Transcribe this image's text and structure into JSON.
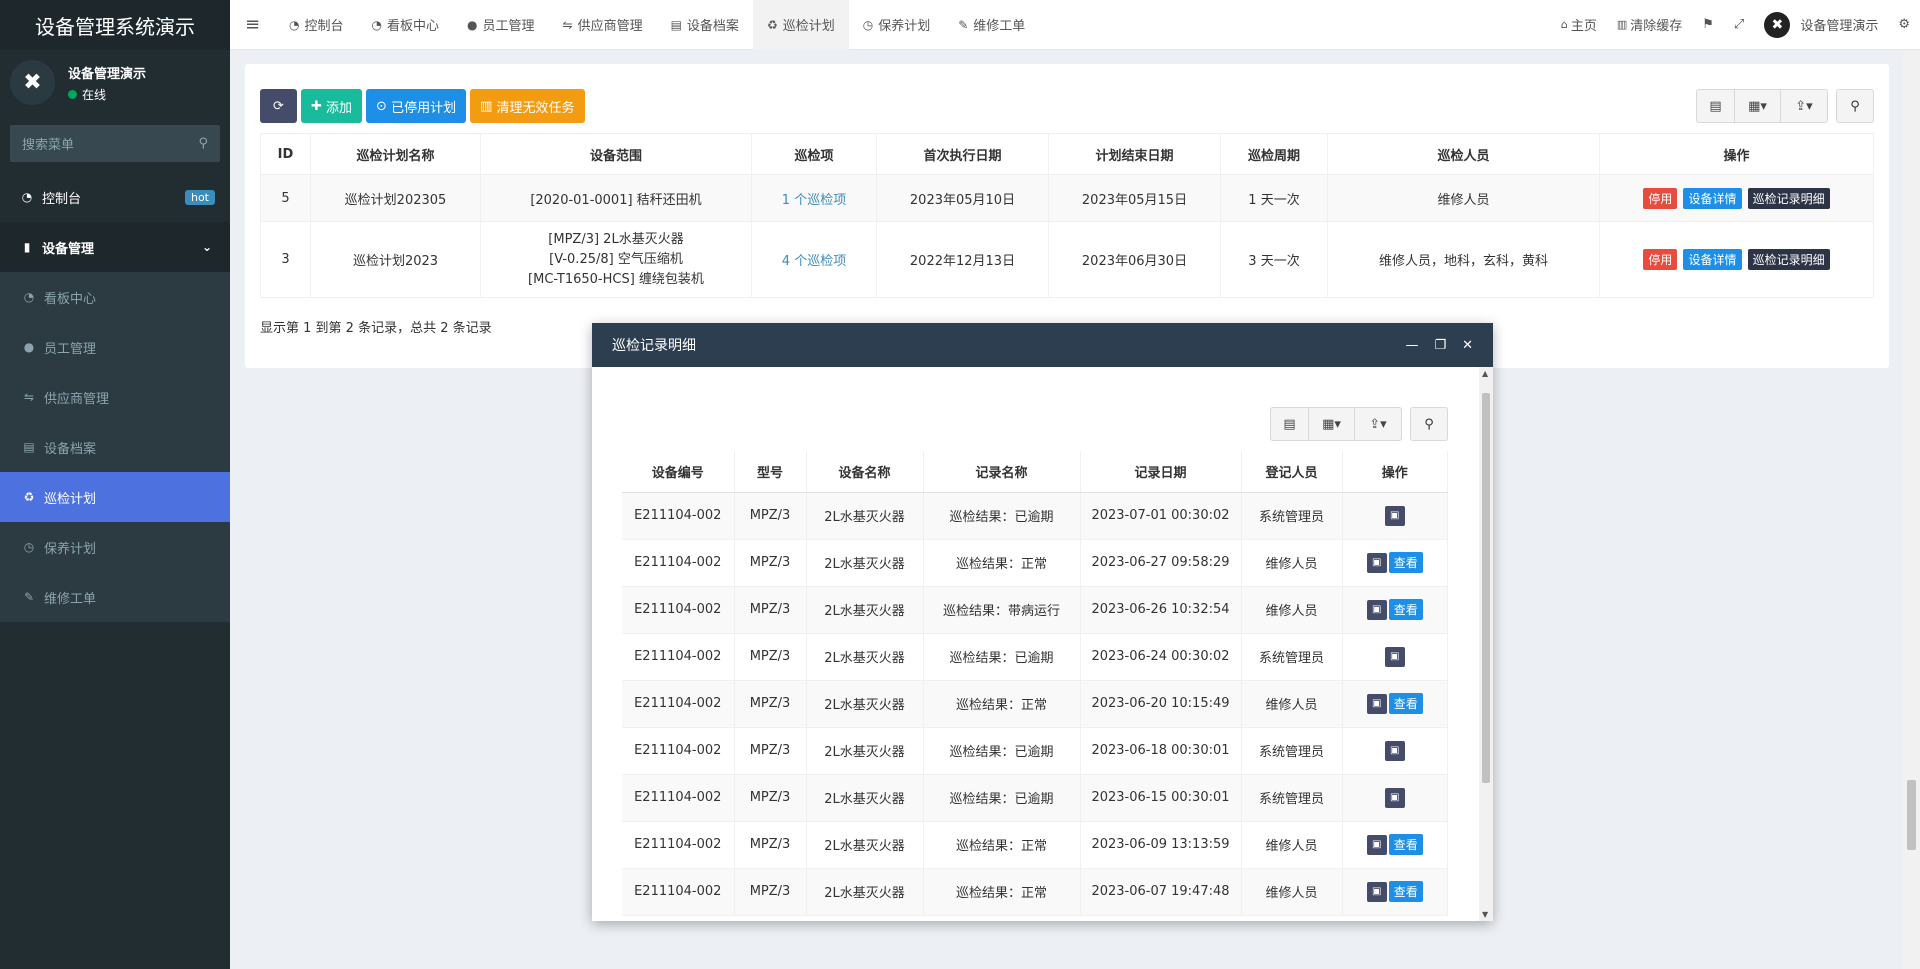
{
  "sidebar": {
    "brand": "设备管理系统演示",
    "user_name": "设备管理演示",
    "user_status": "在线",
    "search_placeholder": "搜索菜单",
    "items": [
      {
        "label": "控制台",
        "badge": "hot"
      },
      {
        "label": "设备管理"
      },
      {
        "label": "看板中心"
      },
      {
        "label": "员工管理"
      },
      {
        "label": "供应商管理"
      },
      {
        "label": "设备档案"
      },
      {
        "label": "巡检计划"
      },
      {
        "label": "保养计划"
      },
      {
        "label": "维修工单"
      }
    ]
  },
  "topbar": {
    "tabs": [
      "控制台",
      "看板中心",
      "员工管理",
      "供应商管理",
      "设备档案",
      "巡检计划",
      "保养计划",
      "维修工单"
    ],
    "home": "主页",
    "clear_cache": "清除缓存",
    "user": "设备管理演示"
  },
  "toolbar": {
    "add": "添加",
    "disabled_plans": "已停用计划",
    "clear_invalid": "清理无效任务"
  },
  "main_table": {
    "headers": [
      "ID",
      "巡检计划名称",
      "设备范围",
      "巡检项",
      "首次执行日期",
      "计划结束日期",
      "巡检周期",
      "巡检人员",
      "操作"
    ],
    "rows": [
      {
        "id": "5",
        "name": "巡检计划202305",
        "scope": [
          "[2020-01-0001] 秸秆还田机"
        ],
        "items": "1 个巡检项",
        "first": "2023年05月10日",
        "end": "2023年05月15日",
        "cycle": "1 天一次",
        "staff": "维修人员"
      },
      {
        "id": "3",
        "name": "巡检计划2023",
        "scope": [
          "[MPZ/3] 2L水基灭火器",
          "[V-0.25/8] 空气压缩机",
          "[MC-T1650-HCS] 缠绕包装机"
        ],
        "items": "4 个巡检项",
        "first": "2022年12月13日",
        "end": "2023年06月30日",
        "cycle": "3 天一次",
        "staff": "维修人员，地科，玄科，黄科"
      }
    ],
    "actions": {
      "disable": "停用",
      "detail": "设备详情",
      "records": "巡检记录明细"
    }
  },
  "pagination_info": "显示第 1 到第 2 条记录，总共 2 条记录",
  "modal": {
    "title": "巡检记录明细",
    "headers": [
      "设备编号",
      "型号",
      "设备名称",
      "记录名称",
      "记录日期",
      "登记人员",
      "操作"
    ],
    "view_label": "查看",
    "rows": [
      {
        "code": "E211104-002",
        "model": "MPZ/3",
        "name": "2L水基灭火器",
        "record": "巡检结果：已逾期",
        "date": "2023-07-01 00:30:02",
        "user": "系统管理员",
        "view": false
      },
      {
        "code": "E211104-002",
        "model": "MPZ/3",
        "name": "2L水基灭火器",
        "record": "巡检结果：正常",
        "date": "2023-06-27 09:58:29",
        "user": "维修人员",
        "view": true
      },
      {
        "code": "E211104-002",
        "model": "MPZ/3",
        "name": "2L水基灭火器",
        "record": "巡检结果：带病运行",
        "date": "2023-06-26 10:32:54",
        "user": "维修人员",
        "view": true
      },
      {
        "code": "E211104-002",
        "model": "MPZ/3",
        "name": "2L水基灭火器",
        "record": "巡检结果：已逾期",
        "date": "2023-06-24 00:30:02",
        "user": "系统管理员",
        "view": false
      },
      {
        "code": "E211104-002",
        "model": "MPZ/3",
        "name": "2L水基灭火器",
        "record": "巡检结果：正常",
        "date": "2023-06-20 10:15:49",
        "user": "维修人员",
        "view": true
      },
      {
        "code": "E211104-002",
        "model": "MPZ/3",
        "name": "2L水基灭火器",
        "record": "巡检结果：已逾期",
        "date": "2023-06-18 00:30:01",
        "user": "系统管理员",
        "view": false
      },
      {
        "code": "E211104-002",
        "model": "MPZ/3",
        "name": "2L水基灭火器",
        "record": "巡检结果：已逾期",
        "date": "2023-06-15 00:30:01",
        "user": "系统管理员",
        "view": false
      },
      {
        "code": "E211104-002",
        "model": "MPZ/3",
        "name": "2L水基灭火器",
        "record": "巡检结果：正常",
        "date": "2023-06-09 13:13:59",
        "user": "维修人员",
        "view": true
      },
      {
        "code": "E211104-002",
        "model": "MPZ/3",
        "name": "2L水基灭火器",
        "record": "巡检结果：正常",
        "date": "2023-06-07 19:47:48",
        "user": "维修人员",
        "view": true
      }
    ]
  },
  "colors": {
    "sidebar": "#222d32",
    "active": "#4d72e0",
    "green": "#18bc9c",
    "blue": "#1e8fe6",
    "orange": "#f39c12",
    "red": "#e74c3c",
    "modal_header": "#2c3e50"
  }
}
